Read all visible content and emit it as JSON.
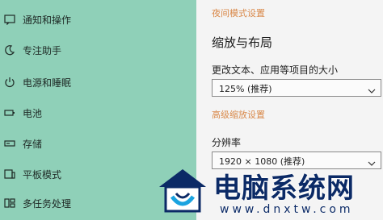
{
  "sidebar": {
    "items": [
      {
        "icon": "notification-icon",
        "label": "通知和操作"
      },
      {
        "icon": "moon-icon",
        "label": "专注助手"
      },
      {
        "icon": "power-icon",
        "label": "电源和睡眠"
      },
      {
        "icon": "battery-icon",
        "label": "电池"
      },
      {
        "icon": "storage-icon",
        "label": "存储"
      },
      {
        "icon": "tablet-mode-icon",
        "label": "平板模式"
      },
      {
        "icon": "multitasking-icon",
        "label": "多任务处理"
      }
    ]
  },
  "main": {
    "night_light_link": "夜间模式设置",
    "section_title": "缩放与布局",
    "scale_label": "更改文本、应用等项目的大小",
    "scale_value": "125% (推荐)",
    "advanced_scaling_link": "高级缩放设置",
    "resolution_label": "分辨率",
    "resolution_value": "1920 × 1080 (推荐)"
  },
  "watermark": {
    "title": "电脑系统网",
    "url": "www.dnxtw.com"
  },
  "colors": {
    "sidebar_bg": "#8fd0b8",
    "link_orange": "#d9894a",
    "watermark_blue": "#0b2a66"
  }
}
